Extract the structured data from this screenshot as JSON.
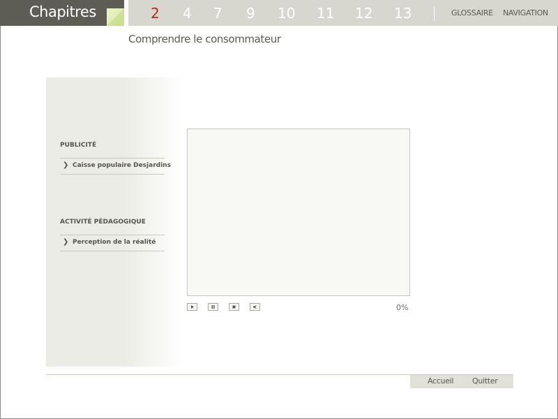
{
  "header": {
    "chapitres_label": "Chapitres",
    "chapters": [
      "2",
      "4",
      "7",
      "9",
      "10",
      "11",
      "12",
      "13"
    ],
    "active_chapter": "2",
    "glossaire_label": "GLOSSAIRE",
    "navigation_label": "NAVIGATION",
    "accent_color": "#b92a17"
  },
  "page": {
    "title": "Comprendre le consommateur"
  },
  "sidebar": {
    "sections": [
      {
        "title": "PUBLICITÉ",
        "link": "Caisse populaire Desjardins"
      },
      {
        "title": "ACTIVITÉ PÉDAGOGIQUE",
        "link": "Perception de la réalité"
      }
    ]
  },
  "player": {
    "progress": "0%",
    "controls": [
      "play-icon",
      "pause-icon",
      "stop-icon",
      "volume-icon"
    ]
  },
  "footer": {
    "accueil_label": "Accueil",
    "quitter_label": "Quitter"
  }
}
